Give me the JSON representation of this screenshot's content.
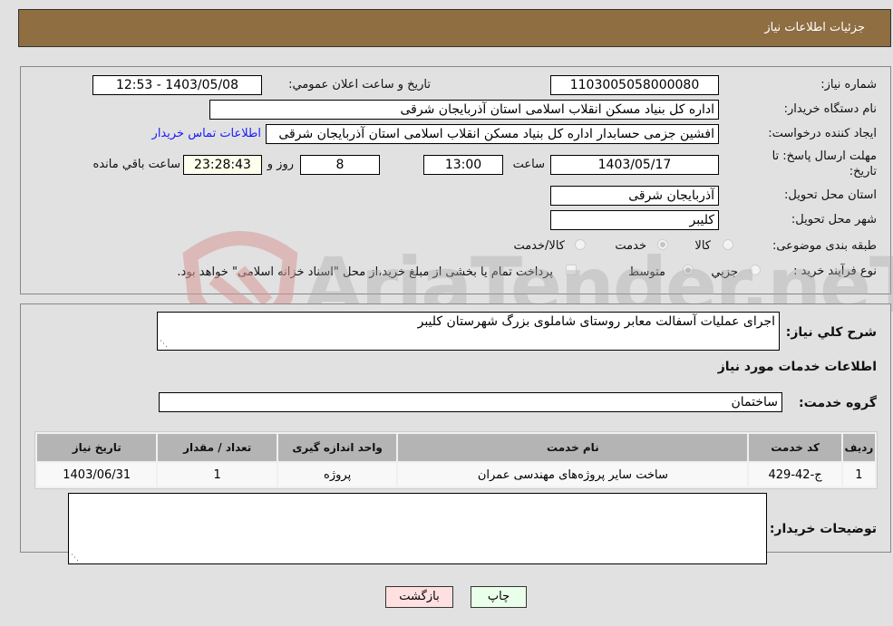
{
  "header": {
    "title": "جزئیات اطلاعات نیاز"
  },
  "details": {
    "need_number_label": "شماره نیاز:",
    "need_number": "1103005058000080",
    "announce_label": "تاریخ و ساعت اعلان عمومي:",
    "announce_value": "1403/05/08 - 12:53",
    "buyer_org_label": "نام دستگاه خریدار:",
    "buyer_org": "اداره کل بنیاد مسکن انقلاب اسلامی استان آذربایجان شرقی",
    "creator_label": "ایجاد کننده درخواست:",
    "creator": "افشین جزمی حسابدار اداره کل بنیاد مسکن انقلاب اسلامی استان آذربایجان شرقی",
    "contact_link": "اطلاعات تماس خریدار",
    "deadline_label_1": "مهلت ارسال پاسخ: تا",
    "deadline_label_2": "تاریخ:",
    "deadline_date": "1403/05/17",
    "time_label": "ساعت",
    "deadline_time": "13:00",
    "days_value": "8",
    "days_label": "روز و",
    "remaining_time": "23:28:43",
    "remaining_label": "ساعت باقي مانده",
    "province_label": "استان محل تحویل:",
    "province": "آذربایجان شرقی",
    "city_label": "شهر محل تحویل:",
    "city": "کلیبر",
    "category_label": "طبقه بندی موضوعی:",
    "category_options": [
      {
        "label": "کالا",
        "checked": false
      },
      {
        "label": "خدمت",
        "checked": true
      },
      {
        "label": "کالا/خدمت",
        "checked": false
      }
    ],
    "purchase_type_label": "نوع فرآیند خرید :",
    "purchase_options": [
      {
        "label": "جزيي",
        "checked": false
      },
      {
        "label": "متوسط",
        "checked": true
      }
    ],
    "treasury_note": "پرداخت تمام یا بخشی از مبلغ خرید،از محل \"اسناد خزانه اسلامی\" خواهد بود."
  },
  "summary": {
    "description_label": "شرح کلي نیاز:",
    "description": "اجرای عملیات آسفالت معابر روستای شاملوی بزرگ شهرستان کلیبر",
    "services_heading": "اطلاعات خدمات مورد نیاز",
    "service_group_label": "گروه خدمت:",
    "service_group": "ساختمان"
  },
  "table": {
    "headers": [
      "ردیف",
      "کد خدمت",
      "نام خدمت",
      "واحد اندازه گیری",
      "تعداد / مقدار",
      "تاریخ نیاز"
    ],
    "rows": [
      [
        "1",
        "ج-42-429",
        "ساخت سایر پروژه‌های مهندسی عمران",
        "پروژه",
        "1",
        "1403/06/31"
      ]
    ]
  },
  "buyer_notes": {
    "label": "توضیحات خریدار:",
    "value": ""
  },
  "buttons": {
    "print": "چاپ",
    "back": "بازگشت"
  },
  "colors": {
    "header_bg": "#8f6e42",
    "print_bg": "#eaffea",
    "back_bg": "#ffe0e0",
    "link": "#1a1aff"
  }
}
